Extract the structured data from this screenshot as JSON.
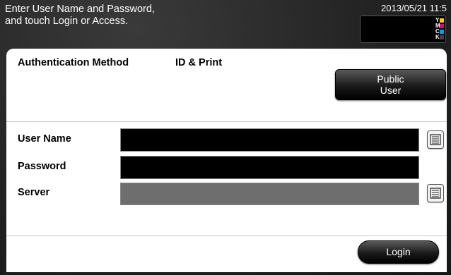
{
  "header": {
    "message": "Enter User Name and Password,\nand touch Login or Access.",
    "datetime": "2013/05/21 11:5"
  },
  "toner": [
    {
      "letter": "Y",
      "color": "#f5d400"
    },
    {
      "letter": "M",
      "color": "#e4007f"
    },
    {
      "letter": "C",
      "color": "#00a0e9"
    },
    {
      "letter": "K",
      "color": "#222222"
    }
  ],
  "auth": {
    "method_label": "Authentication Method",
    "method_value": "ID & Print",
    "public_user_label": "Public\nUser"
  },
  "form": {
    "user_name_label": "User Name",
    "password_label": "Password",
    "server_label": "Server"
  },
  "login_label": "Login"
}
